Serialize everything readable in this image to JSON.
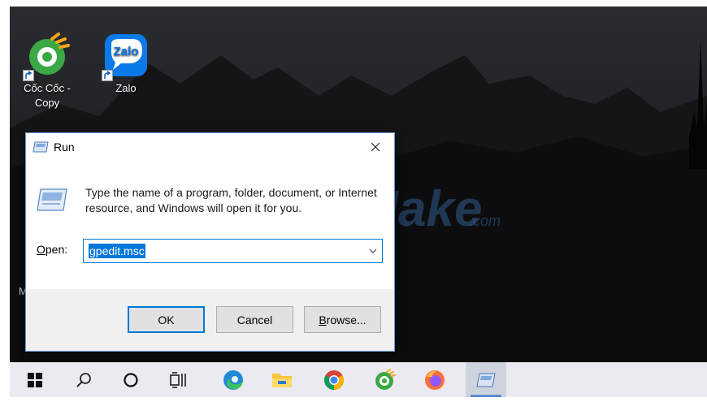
{
  "desktop": {
    "icons": [
      {
        "label": "Cốc Cốc -\nCopy",
        "icon": "coccoc-browser-icon"
      },
      {
        "label": "Zalo",
        "icon": "zalo-icon",
        "logo_text": "Zalo"
      }
    ],
    "edge_fragment": "M"
  },
  "watermark": {
    "text": "TipsMake",
    "suffix": ".com"
  },
  "run_dialog": {
    "title": "Run",
    "description": "Type the name of a program, folder, document, or Internet resource, and Windows will open it for you.",
    "open_label": "Open:",
    "open_label_accesskey": "O",
    "open_label_rest": "pen:",
    "command_value": "gpedit.msc",
    "buttons": {
      "ok": "OK",
      "cancel": "Cancel",
      "browse": "Browse...",
      "browse_accesskey": "B",
      "browse_rest": "rowse..."
    }
  },
  "taskbar": {
    "items": [
      {
        "name": "start-button",
        "icon": "windows-logo-icon"
      },
      {
        "name": "search-button",
        "icon": "search-icon"
      },
      {
        "name": "cortana-button",
        "icon": "cortana-circle-icon"
      },
      {
        "name": "task-view-button",
        "icon": "task-view-icon"
      },
      {
        "name": "edge",
        "icon": "edge-browser-icon"
      },
      {
        "name": "file-explorer",
        "icon": "folder-icon"
      },
      {
        "name": "chrome",
        "icon": "chrome-icon"
      },
      {
        "name": "coccoc",
        "icon": "coccoc-browser-icon"
      },
      {
        "name": "firefox",
        "icon": "firefox-icon"
      },
      {
        "name": "run",
        "icon": "run-dialog-icon",
        "active": true
      }
    ]
  },
  "colors": {
    "accent": "#0078d7",
    "selection": "#0078d7",
    "taskbar": "#eaeaf0"
  }
}
